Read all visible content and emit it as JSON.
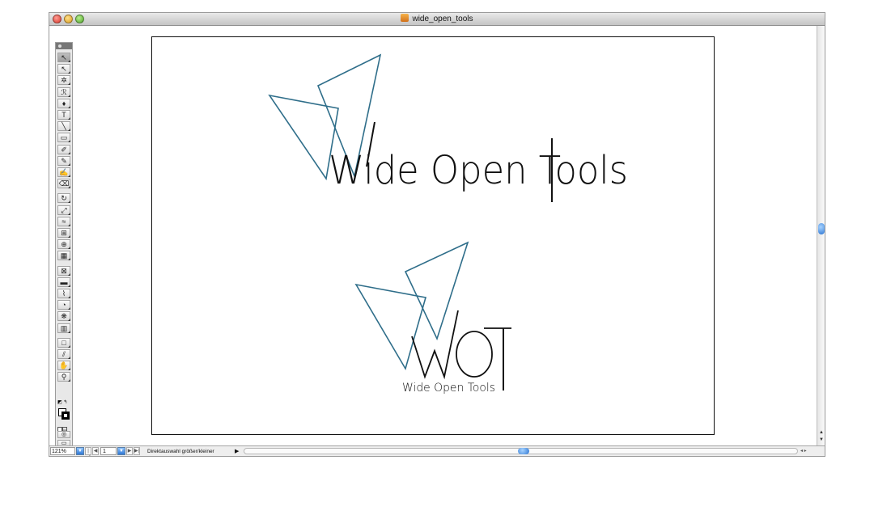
{
  "window": {
    "title": "wide_open_tools"
  },
  "toolbox": {
    "tools": [
      {
        "name": "selection-tool-icon",
        "glyph": "↖",
        "selected": true
      },
      {
        "name": "direct-selection-tool-icon",
        "glyph": "↖"
      },
      {
        "name": "magic-wand-tool-icon",
        "glyph": "✲"
      },
      {
        "name": "lasso-tool-icon",
        "glyph": "ℛ"
      },
      {
        "name": "pen-tool-icon",
        "glyph": "♦"
      },
      {
        "name": "type-tool-icon",
        "glyph": "T"
      },
      {
        "name": "line-segment-tool-icon",
        "glyph": "╲"
      },
      {
        "name": "rectangle-tool-icon",
        "glyph": "▭"
      },
      {
        "name": "paintbrush-tool-icon",
        "glyph": "✐"
      },
      {
        "name": "pencil-tool-icon",
        "glyph": "✎"
      },
      {
        "name": "blob-brush-tool-icon",
        "glyph": "✍"
      },
      {
        "name": "eraser-tool-icon",
        "glyph": "⌫"
      },
      {
        "name": "rotate-tool-icon",
        "glyph": "↻"
      },
      {
        "name": "scale-tool-icon",
        "glyph": "⤢"
      },
      {
        "name": "warp-tool-icon",
        "glyph": "≈"
      },
      {
        "name": "free-transform-tool-icon",
        "glyph": "⊞"
      },
      {
        "name": "shape-builder-tool-icon",
        "glyph": "⊕"
      },
      {
        "name": "perspective-grid-tool-icon",
        "glyph": "▦"
      },
      {
        "name": "mesh-tool-icon",
        "glyph": "⊠"
      },
      {
        "name": "gradient-tool-icon",
        "glyph": "▬"
      },
      {
        "name": "eyedropper-tool-icon",
        "glyph": "⌇"
      },
      {
        "name": "blend-tool-icon",
        "glyph": "◔"
      },
      {
        "name": "symbol-sprayer-tool-icon",
        "glyph": "❋"
      },
      {
        "name": "column-graph-tool-icon",
        "glyph": "▥"
      },
      {
        "name": "artboard-tool-icon",
        "glyph": "□"
      },
      {
        "name": "slice-tool-icon",
        "glyph": "⫽"
      },
      {
        "name": "hand-tool-icon",
        "glyph": "✋"
      },
      {
        "name": "zoom-tool-icon",
        "glyph": "⚲"
      }
    ],
    "bottom_icons": [
      "swap-colors-icon",
      "fill-stroke-icon",
      "color-mode-icon",
      "drawing-mode-icon",
      "screen-mode-icon"
    ]
  },
  "artwork": {
    "logo_wordmark": "Wide Open Tools",
    "mark_letters": "WOT",
    "mark_subtitle": "Wide Open Tools",
    "stroke_color": "#2f6e8a",
    "text_color": "#111111"
  },
  "statusbar": {
    "zoom": "121%",
    "page": "1",
    "status_text": "Direktauswahl größer/kleiner",
    "status_arrow": "▶"
  },
  "colors": {
    "accent_blue": "#2f78d4",
    "window_border": "#9a9a9a",
    "logo_teal": "#2f6e8a"
  }
}
